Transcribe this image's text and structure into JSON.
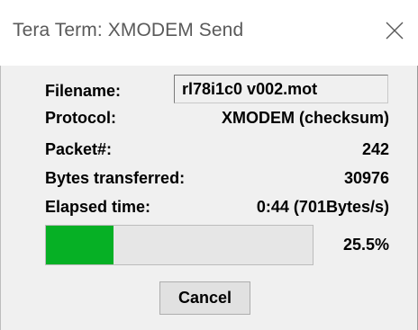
{
  "window": {
    "title": "Tera Term: XMODEM Send"
  },
  "fields": {
    "filename_label": "Filename:",
    "filename_value": "rl78i1c0 v002.mot",
    "protocol_label": "Protocol:",
    "protocol_value": "XMODEM (checksum)",
    "packet_label": "Packet#:",
    "packet_value": "242",
    "bytes_label": "Bytes transferred:",
    "bytes_value": "30976",
    "elapsed_label": "Elapsed time:",
    "elapsed_value": "0:44 (701Bytes/s)"
  },
  "progress": {
    "percent_text": "25.5%",
    "fraction": 0.255,
    "fill_color": "#06b025"
  },
  "buttons": {
    "cancel_label": "Cancel"
  },
  "icons": {
    "close": "close-icon"
  }
}
